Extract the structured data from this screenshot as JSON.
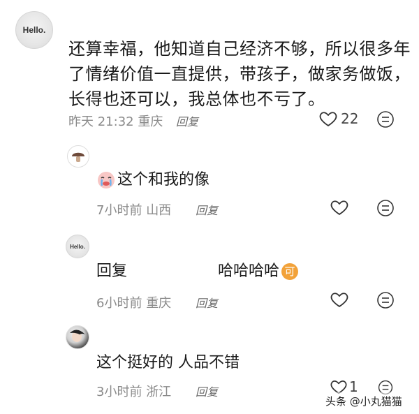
{
  "comments": [
    {
      "avatar_text": "Hello.",
      "text_lines": [
        "还算幸福，他知道自己经济不够，所以很多年",
        "了情绪价值一直提供，带孩子，做家务做饭，",
        "长得也还可以，我总体也不亏了。"
      ],
      "time": "昨天 21:32",
      "location": "重庆",
      "reply_label": "回复",
      "likes": "22"
    }
  ],
  "replies": [
    {
      "avatar": "mushroom-avatar",
      "emoji": "crying-face",
      "text": "这个和我的像",
      "time": "7小时前",
      "location": "山西",
      "reply_label": "回复"
    },
    {
      "avatar_text": "Hello.",
      "prefix": "回复",
      "text": "哈哈哈哈",
      "badge": "可",
      "time": "6小时前",
      "location": "重庆",
      "reply_label": "回复"
    },
    {
      "avatar": "photo-avatar",
      "text": "这个挺好的 人品不错",
      "time": "3小时前",
      "location": "浙江",
      "reply_label": "回复",
      "likes": "1"
    }
  ],
  "watermark": "头条 @小丸猫猫"
}
